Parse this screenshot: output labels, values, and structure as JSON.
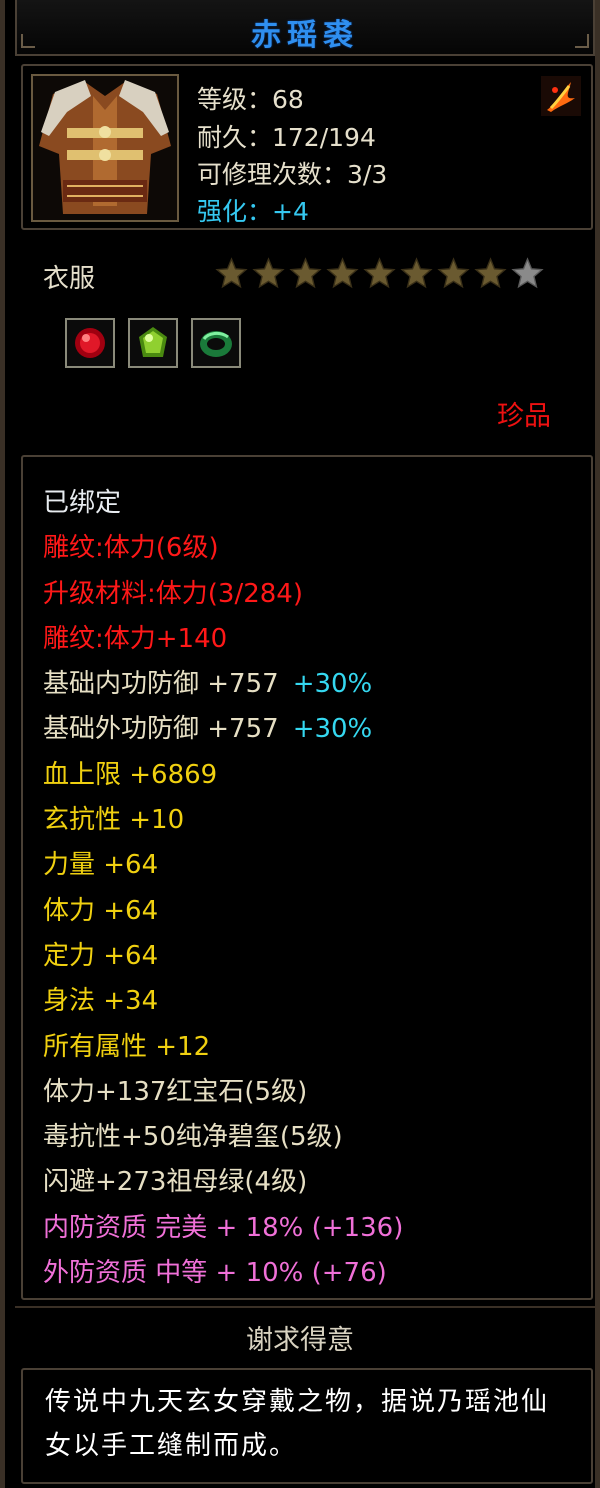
{
  "item": {
    "name": "赤瑶裘",
    "level_text": "等级：68",
    "durability_text": "耐久：172/194",
    "repair_text": "可修理次数：3/3",
    "enhance_text": "强化：+4",
    "type": "衣服",
    "stars_total": 9,
    "stars_filled": 8,
    "rarity": "珍品",
    "icons": {
      "portrait": "robe-portrait-icon",
      "class": "weapon-class-icon"
    },
    "gems": [
      "ruby-gem-icon",
      "peridot-gem-icon",
      "jade-ring-gem-icon"
    ]
  },
  "properties": [
    {
      "segments": [
        {
          "text": "已绑定",
          "color": "white"
        }
      ]
    },
    {
      "segments": [
        {
          "text": "雕纹:体力(6级)",
          "color": "red"
        }
      ]
    },
    {
      "segments": [
        {
          "text": "升级材料:体力(3/284)",
          "color": "red"
        }
      ]
    },
    {
      "segments": [
        {
          "text": "雕纹:体力+140",
          "color": "red"
        }
      ]
    },
    {
      "segments": [
        {
          "text": "基础内功防御 +757",
          "color": "cream"
        },
        {
          "text": "+30%",
          "color": "cyan"
        }
      ]
    },
    {
      "segments": [
        {
          "text": "基础外功防御 +757",
          "color": "cream"
        },
        {
          "text": "+30%",
          "color": "cyan"
        }
      ]
    },
    {
      "segments": [
        {
          "text": "血上限 +6869",
          "color": "yellow"
        }
      ]
    },
    {
      "segments": [
        {
          "text": "玄抗性 +10",
          "color": "yellow"
        }
      ]
    },
    {
      "segments": [
        {
          "text": "力量 +64",
          "color": "yellow"
        }
      ]
    },
    {
      "segments": [
        {
          "text": "体力 +64",
          "color": "yellow"
        }
      ]
    },
    {
      "segments": [
        {
          "text": "定力 +64",
          "color": "yellow"
        }
      ]
    },
    {
      "segments": [
        {
          "text": "身法 +34",
          "color": "yellow"
        }
      ]
    },
    {
      "segments": [
        {
          "text": "所有属性 +12",
          "color": "yellow"
        }
      ]
    },
    {
      "segments": [
        {
          "text": "体力+137红宝石(5级)",
          "color": "cream"
        }
      ]
    },
    {
      "segments": [
        {
          "text": "毒抗性+50纯净碧玺(5级)",
          "color": "cream"
        }
      ]
    },
    {
      "segments": [
        {
          "text": "闪避+273祖母绿(4级)",
          "color": "cream"
        }
      ]
    },
    {
      "segments": [
        {
          "text": "内防资质 完美 + 18% (+136)",
          "color": "pink"
        }
      ]
    },
    {
      "segments": [
        {
          "text": "外防资质 中等 + 10% (+76)",
          "color": "pink"
        }
      ]
    }
  ],
  "footer": {
    "set_name": "谢求得意",
    "description": "传说中九天玄女穿戴之物，据说乃瑶池仙女以手工缝制而成。"
  }
}
